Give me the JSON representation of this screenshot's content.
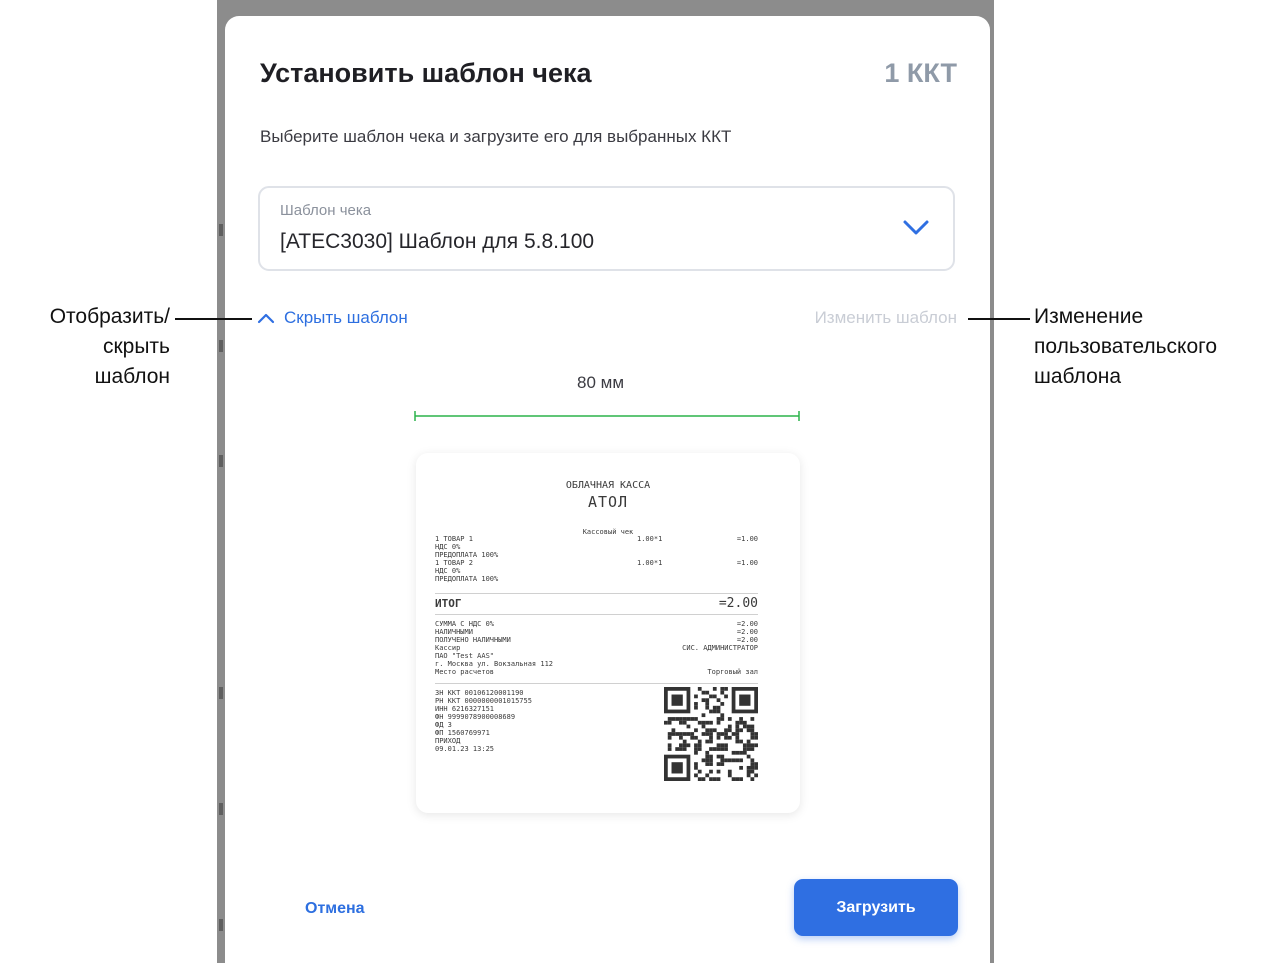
{
  "modal": {
    "title": "Установить шаблон чека",
    "count": "1 ККТ",
    "subtitle": "Выберите шаблон чека и загрузите его для выбранных ККТ",
    "select": {
      "label": "Шаблон чека",
      "value": "[ATEC3030] Шаблон для 5.8.100",
      "icon": "chevron-down-icon"
    },
    "toggle_label": "Скрыть шаблон",
    "edit_label": "Изменить шаблон",
    "width_label": "80 мм",
    "cancel_label": "Отмена",
    "submit_label": "Загрузить"
  },
  "receipt": {
    "header_line1": "ОБЛАЧНАЯ КАССА",
    "header_line2": "АТОЛ",
    "doc_title": "Кассовый чек",
    "items_left": "1 ТОВАР 1\nНДС 0%\nПРЕДОПЛАТА 100%\n1 ТОВАР 2\nНДС 0%\nПРЕДОПЛАТА 100%",
    "items_mid": "1.00*1\n\n\n1.00*1",
    "items_right": "=1.00\n\n\n=1.00",
    "total_label": "ИТОГ",
    "total_value": "=2.00",
    "summary_left": "СУММА С НДС 0%\nНАЛИЧНЫМИ\nПОЛУЧЕНО НАЛИЧНЫМИ\nКассир\nПАО \"Test AAS\"\nг. Москва ул. Вокзальная 112\nМесто расчетов",
    "summary_right": "=2.00\n=2.00\n=2.00\nСИС. АДМИНИСТРАТОР\n\n\nТорговый зал",
    "fiscal_left": "ЗН ККТ 00106120001190\nРН ККТ 0000000001015755\nИНН 6216327151\nФН 9999078900008689\nФД 3\nФП 1560769971\nПРИХОД\n09.01.23 13:25"
  },
  "annotations": {
    "left": "Отобразить/\nскрыть\nшаблон",
    "right": "Изменение\nпользовательского\nшаблона"
  },
  "colors": {
    "accent": "#2f6fe2",
    "ruler": "#2bb34a",
    "muted": "#8f9aa8",
    "backdrop": "#8c8c8c"
  }
}
